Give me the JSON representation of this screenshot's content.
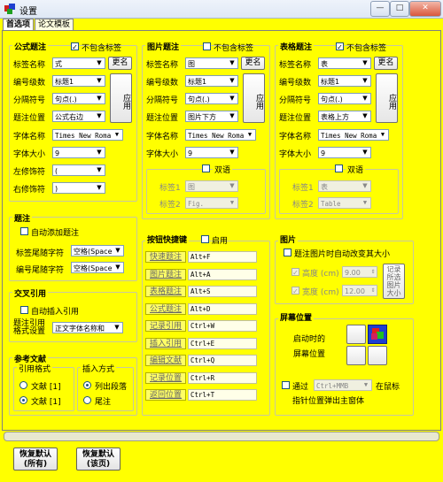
{
  "window": {
    "title": "设置",
    "buttons": [
      "—",
      "□",
      "✕"
    ]
  },
  "tabs": [
    "首选项",
    "论文模板"
  ],
  "formula": {
    "title": "公式题注",
    "exclude_label": "不包含标签",
    "exclude_checked": "✓",
    "tag_name_label": "标签名称",
    "tag_name": "式",
    "rename": "更名",
    "level_label": "编号级数",
    "level": "标题1",
    "sep_label": "分隔符号",
    "sep": "句点(.)",
    "pos_label": "题注位置",
    "pos": "公式右边",
    "apply": "应用",
    "font_label": "字体名称",
    "font": "Times New Roma",
    "size_label": "字体大小",
    "size": "9",
    "left_label": "左修饰符",
    "left": "(",
    "right_label": "右修饰符",
    "right": ")"
  },
  "figure": {
    "title": "图片题注",
    "exclude_label": "不包含标签",
    "tag_name_label": "标签名称",
    "tag_name": "图",
    "rename": "更名",
    "level_label": "编号级数",
    "level": "标题1",
    "sep_label": "分隔符号",
    "sep": "句点(.)",
    "pos_label": "题注位置",
    "pos": "图片下方",
    "apply": "应用",
    "font_label": "字体名称",
    "font": "Times New Roma",
    "size_label": "字体大小",
    "size": "9",
    "bilingual": "双语",
    "tag1_label": "标签1",
    "tag1": "图",
    "tag2_label": "标签2",
    "tag2": "Fig."
  },
  "table": {
    "title": "表格题注",
    "exclude_label": "不包含标签",
    "exclude_checked": "✓",
    "tag_name_label": "标签名称",
    "tag_name": "表",
    "rename": "更名",
    "level_label": "编号级数",
    "level": "标题1",
    "sep_label": "分隔符号",
    "sep": "句点(.)",
    "pos_label": "题注位置",
    "pos": "表格上方",
    "apply": "应用",
    "font_label": "字体名称",
    "font": "Times New Roma",
    "size_label": "字体大小",
    "size": "9",
    "bilingual": "双语",
    "tag1_label": "标签1",
    "tag1": "表",
    "tag2_label": "标签2",
    "tag2": "Table"
  },
  "caption": {
    "title": "题注",
    "auto_add": "自动添加题注",
    "tail_label": "标签尾随字符",
    "tail": "空格(Space",
    "num_tail_label": "编号尾随字符",
    "num_tail": "空格(Space"
  },
  "crossref": {
    "title": "交叉引用",
    "auto_insert": "自动插入引用",
    "format_label_1": "题注引用",
    "format_label_2": "格式设置",
    "format": "正文字体名称和"
  },
  "refs": {
    "title": "参考文献",
    "cite_format": "引用格式",
    "insert_mode": "插入方式",
    "opt1": "文献 [1]",
    "opt2": "文献 [1]",
    "mode1": "列出段落",
    "mode2": "尾注"
  },
  "shortcuts": {
    "title": "按钮快捷键",
    "enable": "启用",
    "items": [
      {
        "label": "快速题注",
        "key": "Alt+F"
      },
      {
        "label": "图片题注",
        "key": "Alt+A"
      },
      {
        "label": "表格题注",
        "key": "Alt+S"
      },
      {
        "label": "公式题注",
        "key": "Alt+D"
      },
      {
        "label": "记录引用",
        "key": "Ctrl+W"
      },
      {
        "label": "插入引用",
        "key": "Ctrl+E"
      },
      {
        "label": "编辑文献",
        "key": "Ctrl+Q"
      },
      {
        "label": "记录位置",
        "key": "Ctrl+R"
      },
      {
        "label": "返回位置",
        "key": "Ctrl+T"
      }
    ]
  },
  "picture": {
    "title": "图片",
    "auto_resize": "题注图片时自动改变其大小",
    "height_label": "高度 (cm)",
    "height": "9.00",
    "width_label": "宽度 (cm)",
    "width": "12.00",
    "record_1": "记录",
    "record_2": "所选",
    "record_3": "图片",
    "record_4": "大小"
  },
  "screen": {
    "title": "屏幕位置",
    "startup_1": "启动时的",
    "startup_2": "屏幕位置",
    "via": "通过",
    "hotkey": "Ctrl+MMB",
    "on_mouse": "在鼠标",
    "popup": "指针位置弹出主窗体"
  },
  "footer": {
    "reset_all_1": "恢复默认",
    "reset_all_2": "(所有)",
    "reset_page_1": "恢复默认",
    "reset_page_2": "(该页)"
  },
  "colors": {
    "background": "#ffff00",
    "selected_cell": "#1f3fd0"
  }
}
